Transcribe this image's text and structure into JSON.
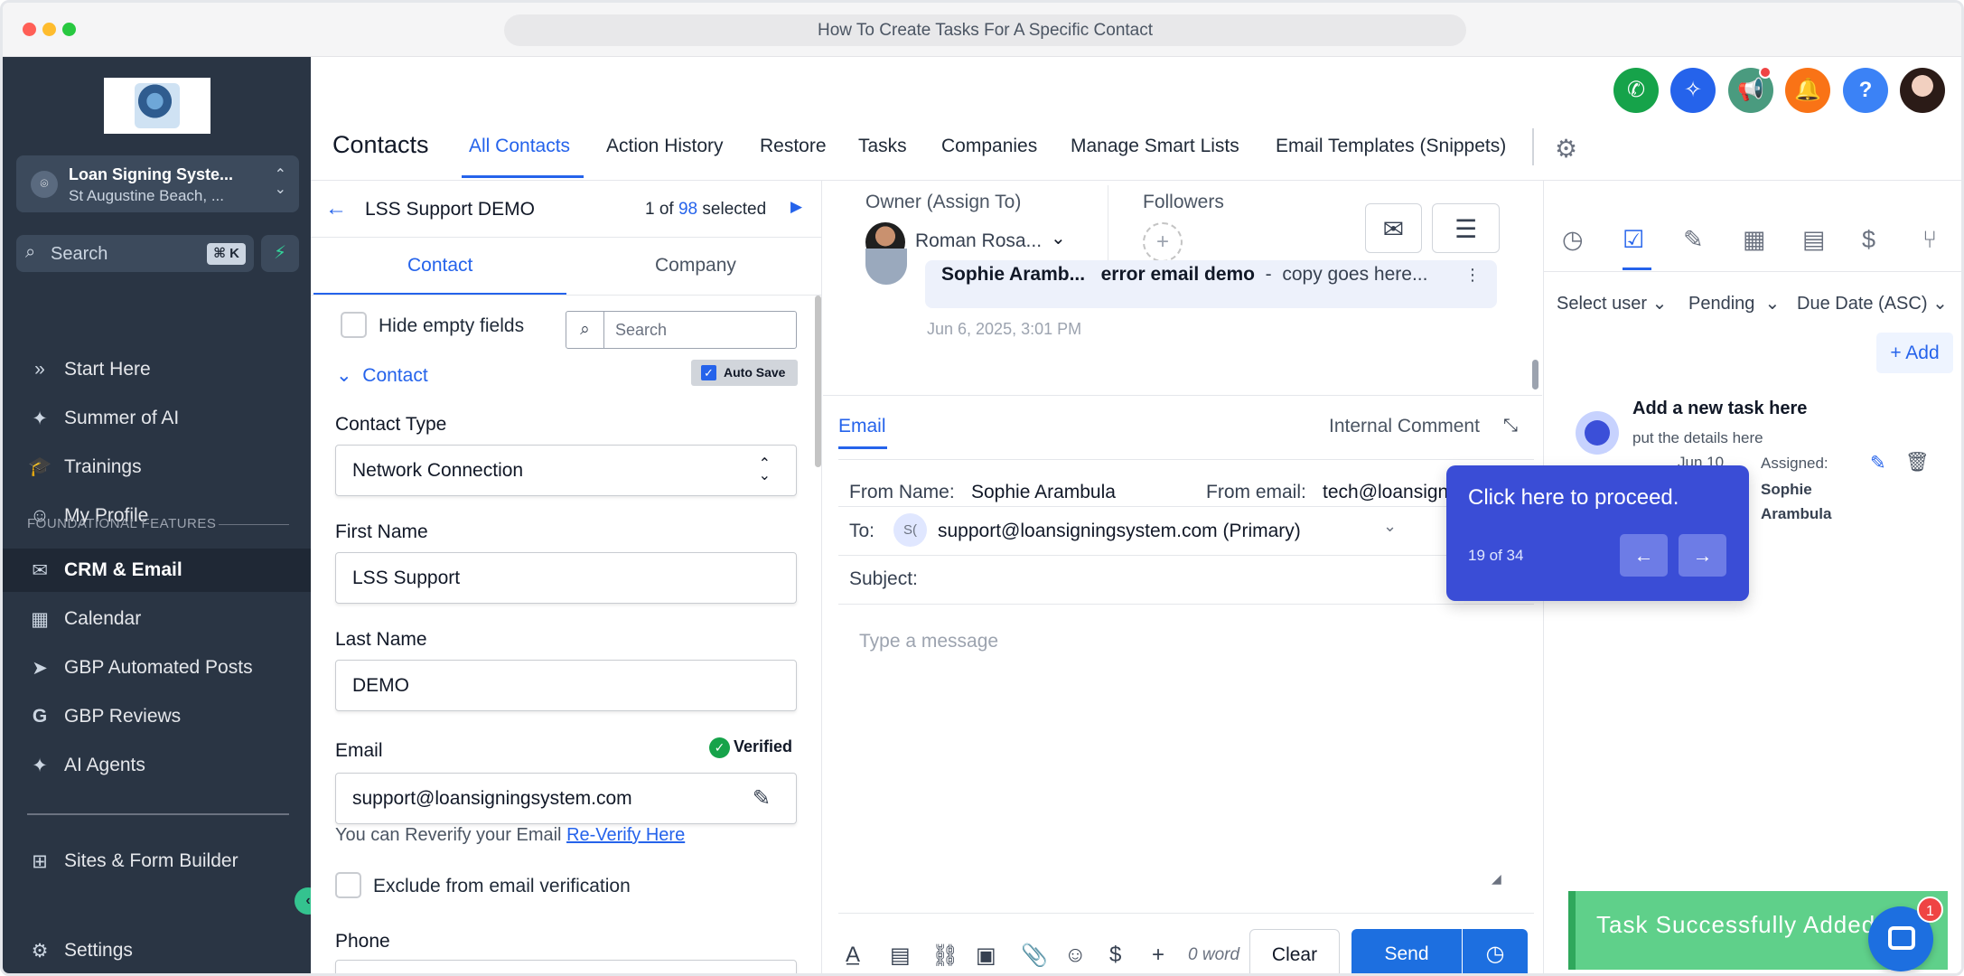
{
  "browser": {
    "url_title": "How To Create Tasks For A Specific Contact"
  },
  "sidebar": {
    "location": {
      "name": "Loan Signing Syste...",
      "sub": "St Augustine Beach, ..."
    },
    "search": {
      "placeholder": "Search",
      "shortcut": "⌘ K"
    },
    "items": [
      {
        "label": "Start Here",
        "icon": "chevrons-right-icon"
      },
      {
        "label": "Summer of AI",
        "icon": "sparkle-icon"
      },
      {
        "label": "Trainings",
        "icon": "graduation-cap-icon"
      },
      {
        "label": "My Profile",
        "icon": "user-circle-icon"
      },
      {
        "label": "CRM & Email",
        "icon": "envelope-icon"
      },
      {
        "label": "Calendar",
        "icon": "calendar-icon"
      },
      {
        "label": "GBP Automated Posts",
        "icon": "send-icon"
      },
      {
        "label": "GBP Reviews",
        "icon": "google-icon"
      },
      {
        "label": "AI Agents",
        "icon": "sparkle-icon"
      },
      {
        "label": "Sites & Form Builder",
        "icon": "sitemap-icon"
      },
      {
        "label": "Settings",
        "icon": "gear-icon"
      }
    ],
    "section_label": "FOUNDATIONAL FEATURES"
  },
  "header": {
    "title": "Contacts",
    "tabs": [
      {
        "label": "All Contacts",
        "active": true
      },
      {
        "label": "Action History"
      },
      {
        "label": "Restore"
      },
      {
        "label": "Tasks"
      },
      {
        "label": "Companies"
      },
      {
        "label": "Manage Smart Lists"
      },
      {
        "label": "Email Templates (Snippets)"
      }
    ]
  },
  "contact_panel": {
    "name": "LSS Support DEMO",
    "position_prefix": "1 of",
    "total": "98",
    "position_suffix": "selected",
    "tabs": {
      "contact": "Contact",
      "company": "Company"
    },
    "hide_empty": "Hide empty fields",
    "search_placeholder": "Search",
    "section": "Contact",
    "autosave": "Auto Save",
    "contact_type": {
      "label": "Contact Type",
      "value": "Network Connection"
    },
    "first_name": {
      "label": "First Name",
      "value": "LSS Support"
    },
    "last_name": {
      "label": "Last Name",
      "value": "DEMO"
    },
    "email": {
      "label": "Email",
      "value": "support@loansigningsystem.com",
      "status": "Verified"
    },
    "reverify_text": "You can Reverify your Email",
    "reverify_link": "Re-Verify Here",
    "exclude_label": "Exclude from email verification",
    "phone_label": "Phone"
  },
  "conversation": {
    "owner_label": "Owner (Assign To)",
    "owner_name": "Roman Rosa...",
    "followers_label": "Followers",
    "message_sender": "Sophie Aramb...",
    "message_subject": "error email demo",
    "message_preview": "copy goes here...",
    "message_time": "Jun 6, 2025, 3:01 PM",
    "composer": {
      "tab_email": "Email",
      "tab_internal": "Internal Comment",
      "from_name_label": "From Name:",
      "from_name": "Sophie Arambula",
      "from_email_label": "From email:",
      "from_email": "tech@loansign",
      "to_label": "To:",
      "to_initials": "S(",
      "to_value": "support@loansigningsystem.com (Primary)",
      "subject_label": "Subject:",
      "message_placeholder": "Type a message",
      "word_count": "0 word",
      "clear": "Clear",
      "send": "Send"
    }
  },
  "tasks_panel": {
    "filters": {
      "user": "Select user",
      "status": "Pending",
      "sort": "Due Date (ASC)"
    },
    "add": "+ Add",
    "task": {
      "title": "Add a new task here",
      "description": "put the details here",
      "date": "Jun 10",
      "assigned_label": "Assigned:",
      "assignee": "Sophie Arambula"
    }
  },
  "tour": {
    "message": "Click here to proceed.",
    "step": "19 of 34"
  },
  "toast": {
    "message": "Task Successfully Added"
  },
  "chat": {
    "badge": "1"
  },
  "colors": {
    "accent": "#2563eb",
    "sidebar": "#2a3544",
    "tour": "#3a4dd6",
    "success": "#5fd08a"
  }
}
